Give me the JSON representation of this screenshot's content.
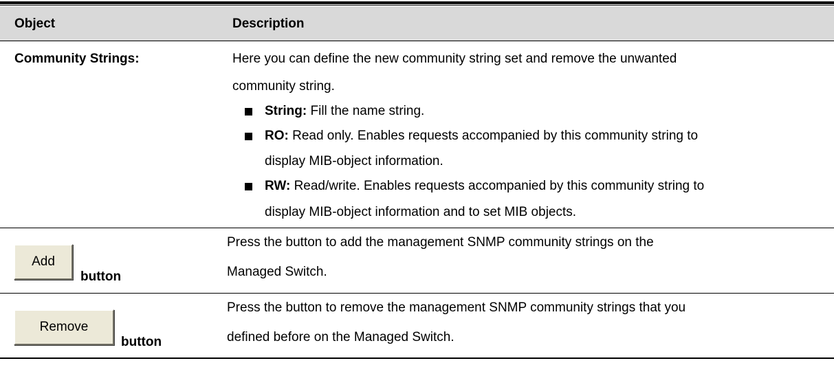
{
  "header": {
    "object": "Object",
    "description": "Description"
  },
  "rows": [
    {
      "object": "Community Strings:",
      "description_lines": [
        "Here you can define the new community string set and remove the unwanted",
        "community string."
      ],
      "bullets": [
        {
          "term": "String:",
          "lines": [
            "Fill the name string."
          ]
        },
        {
          "term": "RO:",
          "lines": [
            "Read only. Enables requests accompanied by this community string to",
            "display MIB-object information."
          ]
        },
        {
          "term": "RW:",
          "lines": [
            "Read/write. Enables requests accompanied by this community string to",
            "display MIB-object information and to set MIB objects."
          ]
        }
      ]
    },
    {
      "button_label": "Add",
      "object_suffix": "button",
      "description_lines": [
        "Press the button to add the management SNMP community strings on the",
        "Managed Switch."
      ]
    },
    {
      "button_label": "Remove",
      "object_suffix": "button",
      "description_lines": [
        "Press the button to remove the management SNMP community strings that you",
        "defined before on the Managed Switch."
      ]
    }
  ]
}
